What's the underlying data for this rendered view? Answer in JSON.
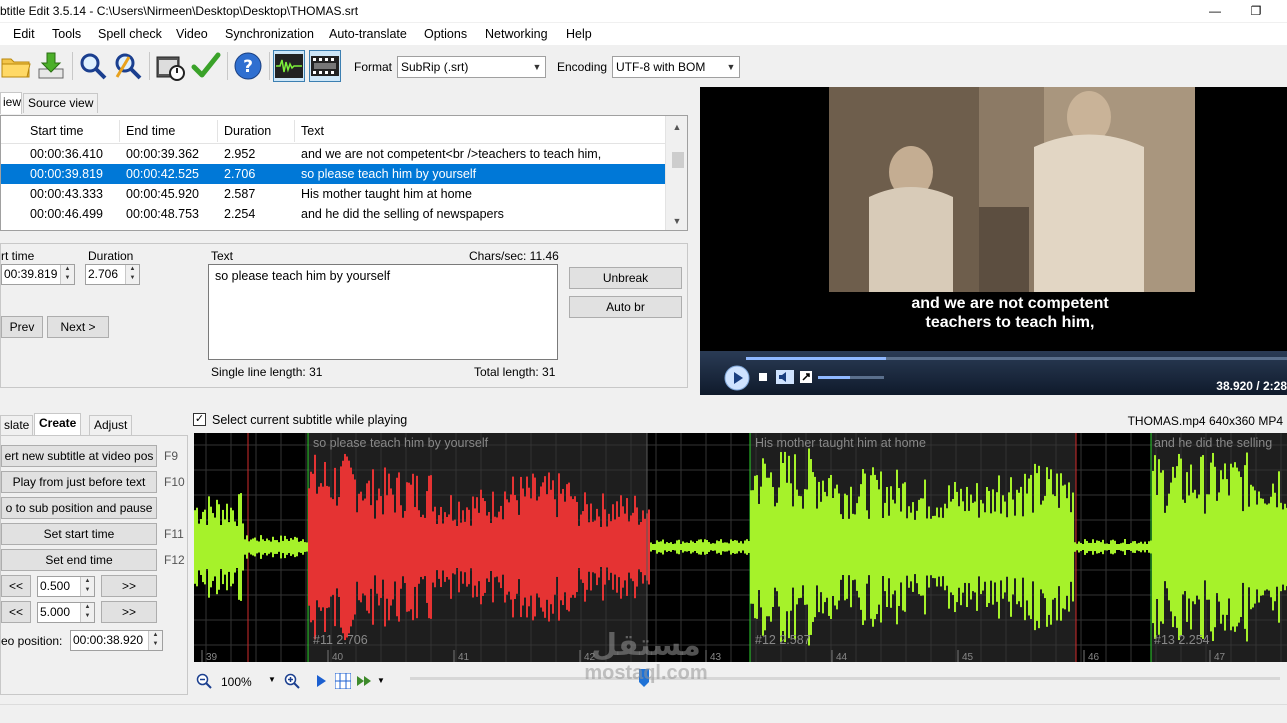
{
  "window": {
    "title": "btitle Edit 3.5.14 - C:\\Users\\Nirmeen\\Desktop\\Desktop\\THOMAS.srt",
    "minimize_glyph": "—",
    "restore_glyph": "❐"
  },
  "menu": [
    "Edit",
    "Tools",
    "Spell check",
    "Video",
    "Synchronization",
    "Auto-translate",
    "Options",
    "Networking",
    "Help"
  ],
  "toolbar": {
    "icons": [
      "open-folder-icon",
      "download-icon",
      "find-icon",
      "replace-icon",
      "visual-sync-icon",
      "spell-check-icon",
      "help-icon",
      "waveform-icon",
      "video-player-icon"
    ],
    "format_label": "Format",
    "format_value": "SubRip (.srt)",
    "encoding_label": "Encoding",
    "encoding_value": "UTF-8 with BOM"
  },
  "view_tabs": [
    "iew",
    "Source view"
  ],
  "grid": {
    "columns": [
      "Start time",
      "End time",
      "Duration",
      "Text"
    ],
    "rows": [
      {
        "start": "00:00:36.410",
        "end": "00:00:39.362",
        "duration": "2.952",
        "text": "and we are not competent<br />teachers to teach him,"
      },
      {
        "start": "00:00:39.819",
        "end": "00:00:42.525",
        "duration": "2.706",
        "text": "so please teach him by yourself"
      },
      {
        "start": "00:00:43.333",
        "end": "00:00:45.920",
        "duration": "2.587",
        "text": "His mother taught him at home"
      },
      {
        "start": "00:00:46.499",
        "end": "00:00:48.753",
        "duration": "2.254",
        "text": "and he did the selling of newspapers"
      }
    ],
    "selected_index": 1
  },
  "edit": {
    "start_time_label": "rt time",
    "start_time_value": "00:39.819",
    "duration_label": "Duration",
    "duration_value": "2.706",
    "text_label": "Text",
    "chars_sec": "Chars/sec: 11.46",
    "text_value": "so please teach him by yourself",
    "single_line_length": "Single line length: 31",
    "total_length": "Total length: 31",
    "unbreak_label": "Unbreak",
    "auto_br_label": "Auto br",
    "prev_label": "Prev",
    "next_label": "Next >"
  },
  "video": {
    "subtitle_line1": "and we are not competent",
    "subtitle_line2": "teachers to teach him,",
    "time": "38.920 / 2:28",
    "file_info": "THOMAS.mp4 640x360 MP4"
  },
  "bottom_tabs": [
    "slate",
    "Create",
    "Adjust"
  ],
  "select_while_playing": "Select current subtitle while playing",
  "create_panel": {
    "insert_new": "ert new subtitle at video pos",
    "insert_key": "F9",
    "play_before": "Play from just before text",
    "play_before_key": "F10",
    "goto_sub": "o to sub position and pause",
    "set_start": "Set start time",
    "set_start_key": "F11",
    "set_end": "Set end time",
    "set_end_key": "F12",
    "back": "<<",
    "fwd": ">>",
    "step1": "0.500",
    "step2": "5.000",
    "video_pos_label": "eo position:",
    "video_pos_value": "00:00:38.920"
  },
  "waveform": {
    "labels": [
      {
        "text": "so please teach him by yourself"
      },
      {
        "text": "His mother taught him at home"
      },
      {
        "text": "and he did the selling"
      }
    ],
    "numbers": [
      {
        "text": "#11  2.706"
      },
      {
        "text": "#12  2.587"
      },
      {
        "text": "#13  2.254"
      }
    ],
    "ticks": [
      "39",
      "40",
      "41",
      "42",
      "43",
      "44",
      "45",
      "46",
      "47"
    ],
    "colors": {
      "selected": "#e53333",
      "normal": "#a6f22a",
      "background": "#000000"
    }
  },
  "zoom": "100%",
  "watermark": {
    "arabic": "مستقل",
    "latin": "mostaql.com"
  }
}
